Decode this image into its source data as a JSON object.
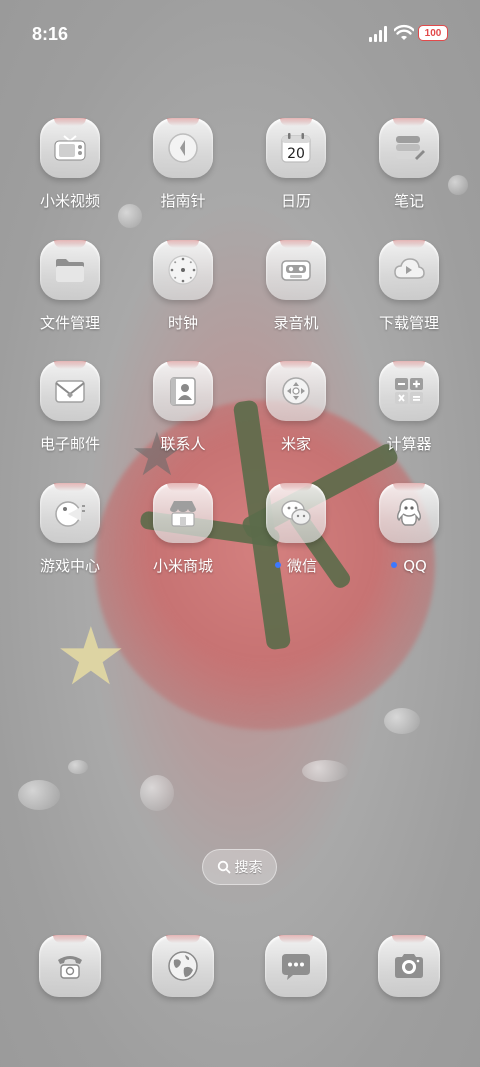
{
  "status_bar": {
    "time": "8:16",
    "battery": "100"
  },
  "apps": [
    {
      "label": "小米视频",
      "icon": "tv-icon",
      "badge": false
    },
    {
      "label": "指南针",
      "icon": "compass-icon",
      "badge": false
    },
    {
      "label": "日历",
      "icon": "calendar-icon",
      "badge": false,
      "date": "20"
    },
    {
      "label": "笔记",
      "icon": "notes-icon",
      "badge": false
    },
    {
      "label": "文件管理",
      "icon": "folder-icon",
      "badge": false
    },
    {
      "label": "时钟",
      "icon": "clock-icon",
      "badge": false
    },
    {
      "label": "录音机",
      "icon": "recorder-icon",
      "badge": false
    },
    {
      "label": "下载管理",
      "icon": "download-icon",
      "badge": false
    },
    {
      "label": "电子邮件",
      "icon": "mail-icon",
      "badge": false
    },
    {
      "label": "联系人",
      "icon": "contacts-icon",
      "badge": false
    },
    {
      "label": "米家",
      "icon": "mihome-icon",
      "badge": false
    },
    {
      "label": "计算器",
      "icon": "calculator-icon",
      "badge": false
    },
    {
      "label": "游戏中心",
      "icon": "game-icon",
      "badge": false
    },
    {
      "label": "小米商城",
      "icon": "store-icon",
      "badge": false
    },
    {
      "label": "微信",
      "icon": "wechat-icon",
      "badge": true
    },
    {
      "label": "QQ",
      "icon": "qq-icon",
      "badge": true
    }
  ],
  "search": {
    "label": "搜索"
  },
  "dock": [
    {
      "icon": "phone-icon"
    },
    {
      "icon": "browser-icon"
    },
    {
      "icon": "messages-icon"
    },
    {
      "icon": "camera-icon"
    }
  ],
  "colors": {
    "badge_dot": "#3d78ff",
    "battery_text": "#e2494a"
  }
}
